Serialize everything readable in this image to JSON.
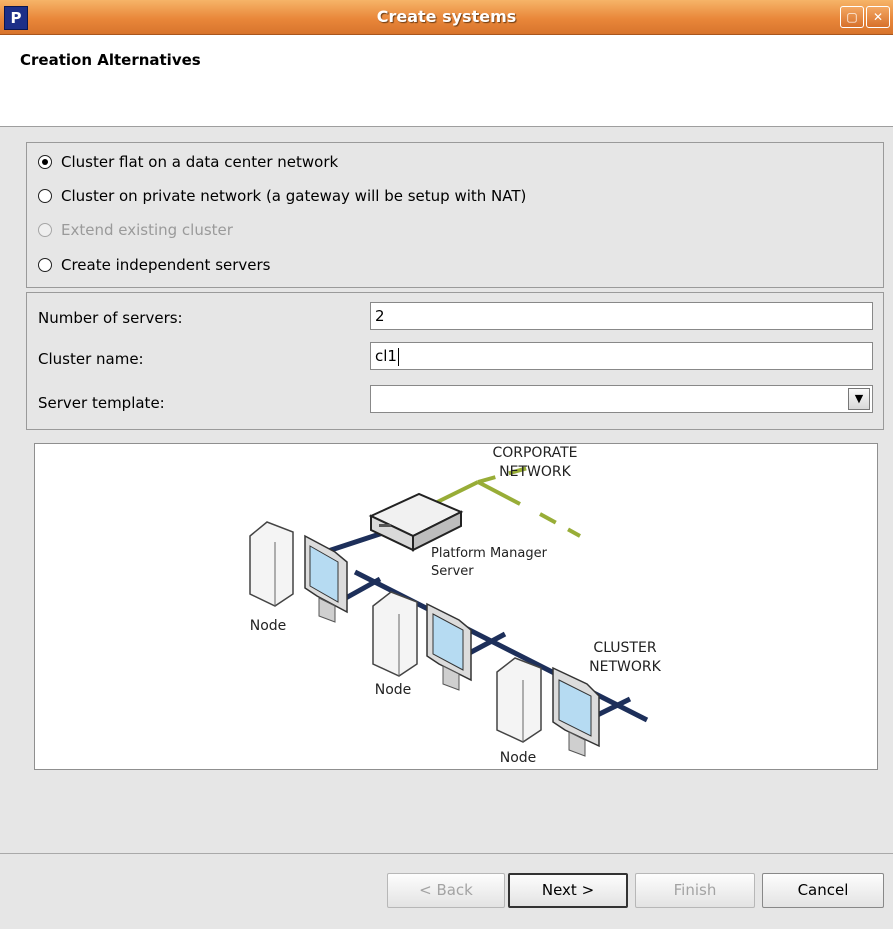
{
  "window": {
    "title": "Create systems",
    "app_icon_letter": "P",
    "restore_icon": "▢",
    "close_icon": "✕"
  },
  "header": {
    "title": "Creation Alternatives"
  },
  "options": [
    {
      "label": "Cluster flat on a data center network",
      "mnemonic": "l",
      "selected": true,
      "enabled": true
    },
    {
      "label": "Cluster on private network (a gateway will be setup with NAT)",
      "mnemonic": "o",
      "selected": false,
      "enabled": true
    },
    {
      "label": "Extend existing cluster",
      "mnemonic": "e",
      "selected": false,
      "enabled": false
    },
    {
      "label": "Create independent servers",
      "mnemonic": "s",
      "selected": false,
      "enabled": true
    }
  ],
  "fields": {
    "num_servers": {
      "label": "Number of servers:",
      "value": "2"
    },
    "cluster_name": {
      "label": "Cluster name:",
      "value": "cl1"
    },
    "server_template": {
      "label": "Server template:",
      "value": ""
    }
  },
  "diagram": {
    "corporate_line1": "CORPORATE",
    "corporate_line2": "NETWORK",
    "pm_line1": "Platform Manager",
    "pm_line2": "Server",
    "cluster_line1": "CLUSTER",
    "cluster_line2": "NETWORK",
    "node1": "Node",
    "node2": "Node",
    "node3": "Node",
    "colors": {
      "corporate": "#98ad37",
      "cluster": "#1d2f5a",
      "screen": "#b6dbf2"
    }
  },
  "buttons": {
    "back": {
      "label": "< Back",
      "enabled": false
    },
    "next": {
      "label": "Next >",
      "enabled": true
    },
    "finish": {
      "label": "Finish",
      "enabled": false
    },
    "cancel": {
      "label": "Cancel",
      "enabled": true
    }
  }
}
